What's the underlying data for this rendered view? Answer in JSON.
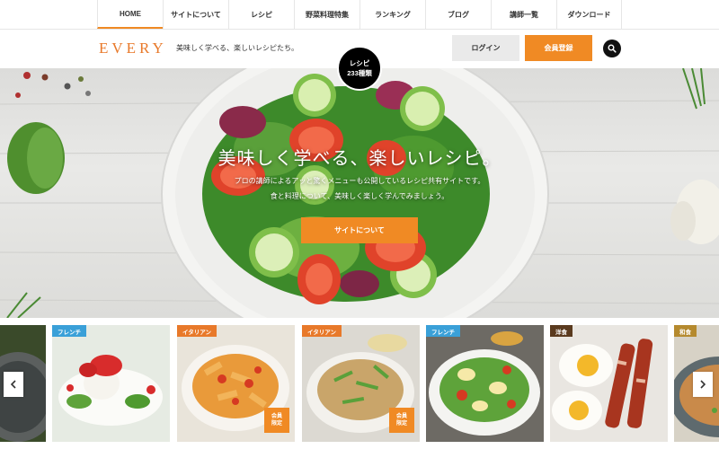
{
  "nav": {
    "items": [
      {
        "label": "HOME"
      },
      {
        "label": "サイトについて"
      },
      {
        "label": "レシピ"
      },
      {
        "label": "野菜料理特集"
      },
      {
        "label": "ランキング"
      },
      {
        "label": "ブログ"
      },
      {
        "label": "講師一覧"
      },
      {
        "label": "ダウンロード"
      }
    ],
    "active_index": 0
  },
  "header": {
    "logo": "EVERY",
    "tagline": "美味しく学べる、楽しいレシピたち。",
    "login_label": "ログイン",
    "signup_label": "会員登録",
    "search_icon": "search-icon"
  },
  "badge": {
    "line1": "レシピ",
    "line2": "233種類"
  },
  "hero": {
    "title": "美味しく学べる、楽しいレシピ。",
    "desc_line1": "プロの講師によるアッと驚くメニューも公開しているレシピ共有サイトです。",
    "desc_line2": "食と料理について、美味しく楽しく学んでみましょう。",
    "cta_label": "サイトについて"
  },
  "carousel": {
    "prev_icon": "chevron-left-icon",
    "next_icon": "chevron-right-icon",
    "cards": [
      {
        "category": "フレンチ",
        "member": false
      },
      {
        "category": "イタリアン",
        "member": true
      },
      {
        "category": "イタリアン",
        "member": true
      },
      {
        "category": "フレンチ",
        "member": false
      },
      {
        "category": "洋食",
        "member": false
      },
      {
        "category": "和食",
        "member": false
      }
    ],
    "member_label_line1": "会員",
    "member_label_line2": "限定"
  },
  "colors": {
    "accent": "#f08a24",
    "tag_french": "#3aa0d8",
    "tag_italian": "#e8792a",
    "tag_western": "#5a3a1e",
    "tag_japanese": "#b58a2e"
  }
}
